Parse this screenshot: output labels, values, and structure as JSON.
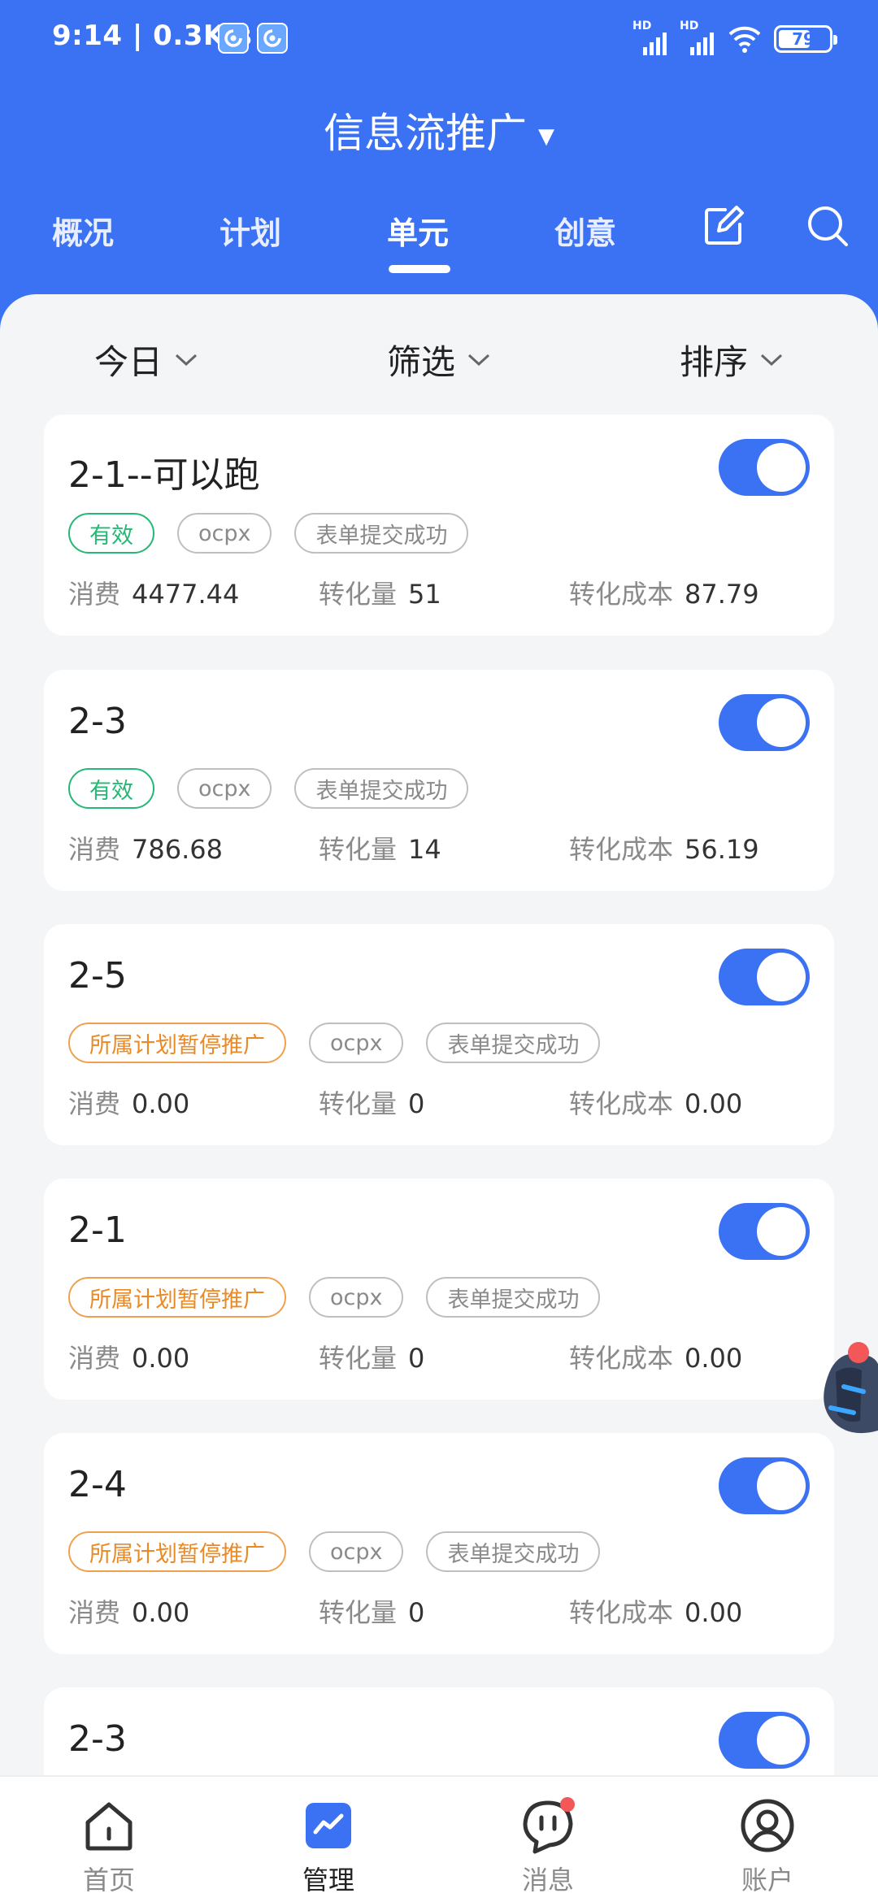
{
  "status_bar": {
    "time": "9:14 | 0.3K/s",
    "net1": "HD",
    "net2": "HD",
    "battery": "79"
  },
  "header": {
    "title": "信息流推广",
    "tabs": [
      {
        "label": "概况"
      },
      {
        "label": "计划"
      },
      {
        "label": "单元"
      },
      {
        "label": "创意"
      }
    ],
    "active_tab": "单元",
    "icons": [
      "edit-icon",
      "search-icon"
    ]
  },
  "filters": [
    {
      "label": "今日"
    },
    {
      "label": "筛选"
    },
    {
      "label": "排序"
    }
  ],
  "labels": {
    "cost": "消费",
    "conversions": "转化量",
    "cost_per_conversion": "转化成本"
  },
  "units": [
    {
      "name": "2-1--可以跑",
      "enabled": true,
      "status": "有效",
      "status_color": "#25b874",
      "bid": "ocpx",
      "goal": "表单提交成功",
      "cost": "4477.44",
      "conversions": "51",
      "cpa": "87.79"
    },
    {
      "name": "2-3",
      "enabled": true,
      "status": "有效",
      "status_color": "#25b874",
      "bid": "ocpx",
      "goal": "表单提交成功",
      "cost": "786.68",
      "conversions": "14",
      "cpa": "56.19"
    },
    {
      "name": "2-5",
      "enabled": true,
      "status": "所属计划暂停推广",
      "status_color": "#e98a26",
      "bid": "ocpx",
      "goal": "表单提交成功",
      "cost": "0.00",
      "conversions": "0",
      "cpa": "0.00"
    },
    {
      "name": "2-1",
      "enabled": true,
      "status": "所属计划暂停推广",
      "status_color": "#e98a26",
      "bid": "ocpx",
      "goal": "表单提交成功",
      "cost": "0.00",
      "conversions": "0",
      "cpa": "0.00"
    },
    {
      "name": "2-4",
      "enabled": true,
      "status": "所属计划暂停推广",
      "status_color": "#e98a26",
      "bid": "ocpx",
      "goal": "表单提交成功",
      "cost": "0.00",
      "conversions": "0",
      "cpa": "0.00"
    },
    {
      "name": "2-3",
      "enabled": true
    }
  ],
  "bottom_nav": [
    {
      "label": "首页",
      "icon": "home-icon"
    },
    {
      "label": "管理",
      "icon": "manage-icon"
    },
    {
      "label": "消息",
      "icon": "message-icon"
    },
    {
      "label": "账户",
      "icon": "account-icon"
    }
  ],
  "colors": {
    "brand": "#3a72f3",
    "valid": "#25b874",
    "paused": "#e98a26",
    "badge": "#f35757"
  }
}
